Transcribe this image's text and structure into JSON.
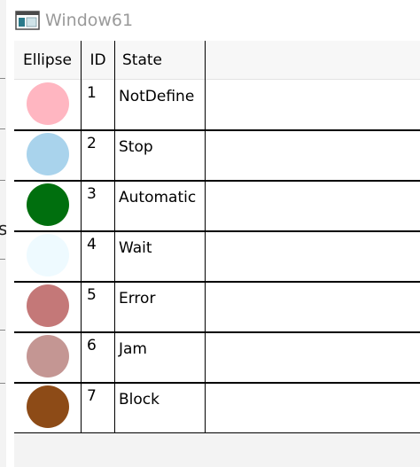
{
  "window": {
    "title": "Window61"
  },
  "grid": {
    "columns": [
      "Ellipse",
      "ID",
      "State"
    ],
    "rows": [
      {
        "id": "1",
        "state": "NotDefine",
        "color": "#FFB6C1"
      },
      {
        "id": "2",
        "state": "Stop",
        "color": "#A9D3EC"
      },
      {
        "id": "3",
        "state": "Automatic",
        "color": "#006F0E"
      },
      {
        "id": "4",
        "state": "Wait",
        "color": "#EEFAFF"
      },
      {
        "id": "5",
        "state": "Error",
        "color": "#C47878"
      },
      {
        "id": "6",
        "state": "Jam",
        "color": "#C49693"
      },
      {
        "id": "7",
        "state": "Block",
        "color": "#8D4B17"
      }
    ]
  },
  "icons": {
    "app": "app-window-icon"
  }
}
